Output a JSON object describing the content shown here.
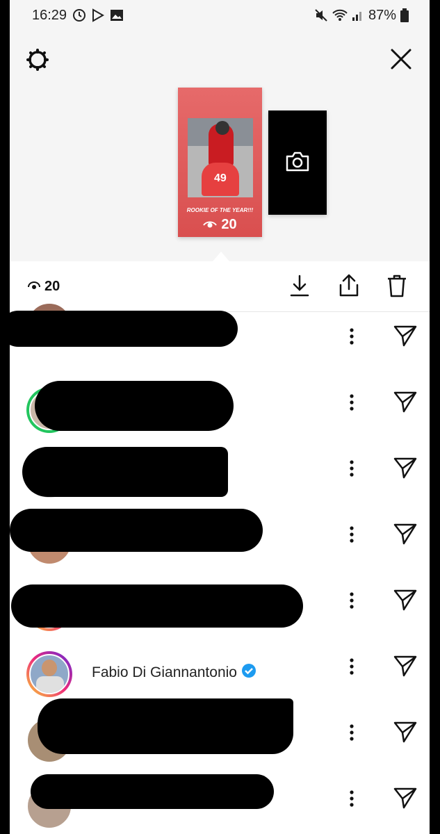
{
  "status_bar": {
    "time": "16:29",
    "battery": "87%",
    "left_icons": [
      "clock-icon",
      "play-store-icon",
      "image-icon"
    ],
    "right_icons": [
      "mute-icon",
      "wifi-icon",
      "signal-icon",
      "battery-icon"
    ]
  },
  "header": {
    "settings_icon": "gear-icon",
    "close_icon": "close-icon"
  },
  "story_thumbnail": {
    "caption": "ROOKIE OF THE YEAR!!!",
    "views": "20",
    "bike_number": "49"
  },
  "camera_card": {
    "icon": "camera-icon"
  },
  "toolbar": {
    "views": "20",
    "actions": [
      "download-icon",
      "share-icon",
      "trash-icon"
    ]
  },
  "viewers": [
    {
      "name": "",
      "redacted": true,
      "ring": "none"
    },
    {
      "name": "",
      "redacted": true,
      "ring": "green"
    },
    {
      "name": "",
      "redacted": true,
      "ring": "none"
    },
    {
      "name": "",
      "redacted": true,
      "ring": "none"
    },
    {
      "name": "",
      "redacted": true,
      "ring": "gradient"
    },
    {
      "name": "Fabio Di Giannantonio",
      "verified": true,
      "redacted": false,
      "ring": "gradient"
    },
    {
      "name": "",
      "redacted": true,
      "ring": "none"
    },
    {
      "name": "",
      "redacted": true,
      "ring": "none"
    }
  ]
}
